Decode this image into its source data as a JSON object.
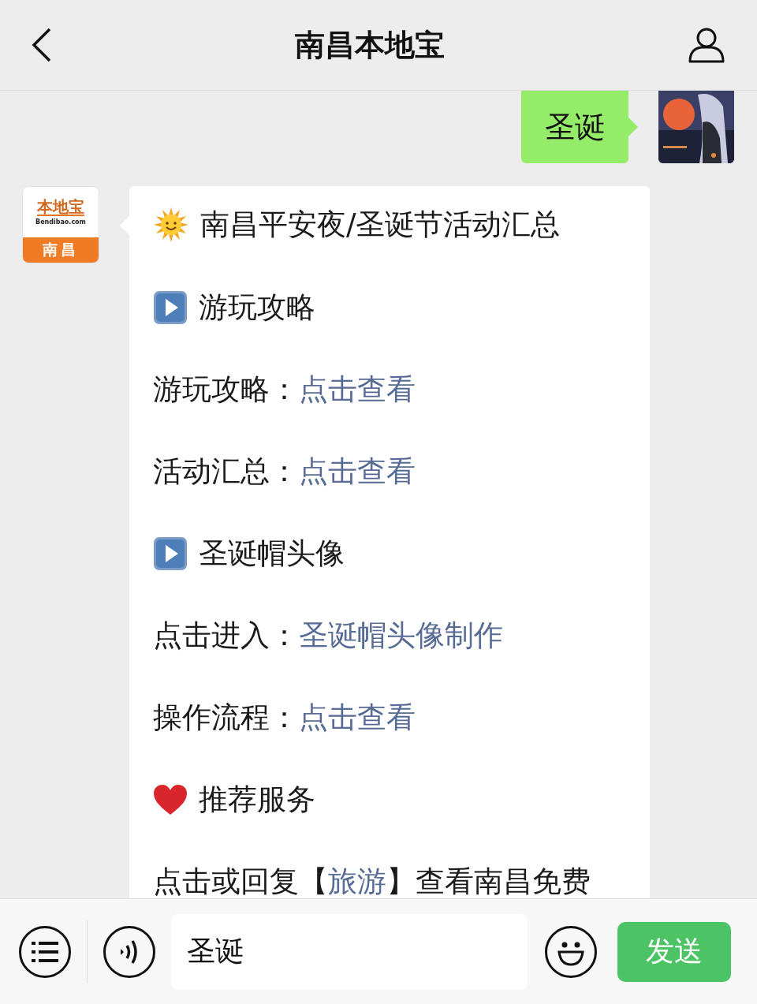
{
  "header": {
    "title": "南昌本地宝"
  },
  "messages": [
    {
      "kind": "outgoing",
      "text": "圣诞"
    },
    {
      "kind": "incoming",
      "logo": {
        "name": "本地宝",
        "site": "Bendibao.com",
        "city": "南昌"
      },
      "lines": [
        {
          "kind": "sun_heading",
          "text": "南昌平安夜/圣诞节活动汇总"
        },
        {
          "kind": "play_heading",
          "text": "游玩攻略"
        },
        {
          "kind": "link",
          "label": "游玩攻略：",
          "link": "点击查看"
        },
        {
          "kind": "link",
          "label": "活动汇总：",
          "link": "点击查看"
        },
        {
          "kind": "play_heading",
          "text": "圣诞帽头像"
        },
        {
          "kind": "link",
          "label": "点击进入：",
          "link": "圣诞帽头像制作"
        },
        {
          "kind": "link",
          "label": "操作流程：",
          "link": "点击查看"
        },
        {
          "kind": "heart_heading",
          "text": "推荐服务"
        },
        {
          "kind": "mixed",
          "before": "点击或回复【",
          "link": "旅游",
          "after": "】查看南昌免费"
        }
      ]
    }
  ],
  "input": {
    "value": "圣诞"
  },
  "send_button": "发送"
}
